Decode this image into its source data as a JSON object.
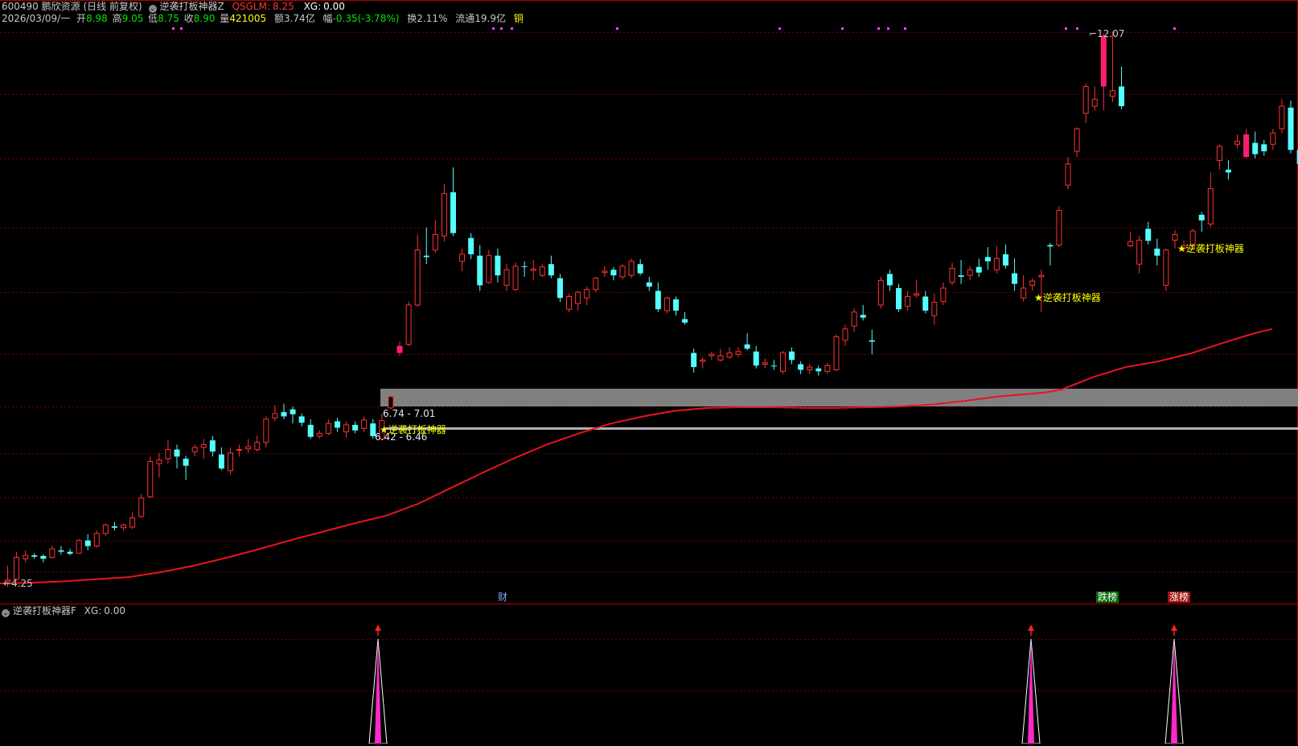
{
  "header": {
    "code": "600490",
    "name": "鹏欣资源",
    "period": "(日线 前复权)",
    "indicator_name": "逆袭打板神器Z",
    "qsglm_label": "QSGLM:",
    "qsglm_value": "8.25",
    "xg_label": "XG:",
    "xg_value": "0.00"
  },
  "quote": {
    "date": "2026/03/09/一",
    "open_label": "开",
    "open": "8.98",
    "high_label": "高",
    "high": "9.05",
    "low_label": "低",
    "low": "8.75",
    "close_label": "收",
    "close": "8.90",
    "volume_label": "量",
    "volume": "421005",
    "amount_label": "额",
    "amount": "3.74亿",
    "change_label": "幅",
    "change": "-0.35(-3.78%)",
    "turnover_label": "换",
    "turnover": "2.11%",
    "float_label": "流通",
    "float": "19.9亿",
    "extra": "铜"
  },
  "annotations": {
    "max_price": "12.07",
    "min_price": "4.25",
    "zone_upper": "6.74 - 7.01",
    "zone_lower": "6.42 - 6.46",
    "signal_label": "★逆袭打板神器"
  },
  "markers": {
    "finance": "财",
    "fall_list": "跌榜",
    "rise_list": "涨榜"
  },
  "sub_panel": {
    "title": "逆袭打板神器F",
    "xg_label": "XG:",
    "xg_value": "0.00"
  },
  "colors": {
    "up": "#ff3232",
    "down": "#54ffff",
    "ma": "#e8141e",
    "signal_candle": "#ff1e6e",
    "signal_text": "#ffff00",
    "zone": "#808080",
    "grid": "#700000",
    "spike": "#ff28c8"
  },
  "chart_data": {
    "type": "candlestick",
    "price_range": [
      4.0,
      12.2
    ],
    "candles": [
      [
        4.28,
        4.5,
        4.2,
        4.3
      ],
      [
        4.31,
        4.7,
        4.29,
        4.62
      ],
      [
        4.6,
        4.72,
        4.55,
        4.65
      ],
      [
        4.65,
        4.68,
        4.6,
        4.63
      ],
      [
        4.64,
        4.66,
        4.55,
        4.6
      ],
      [
        4.62,
        4.78,
        4.6,
        4.74
      ],
      [
        4.72,
        4.78,
        4.66,
        4.7
      ],
      [
        4.7,
        4.74,
        4.65,
        4.67
      ],
      [
        4.68,
        4.88,
        4.67,
        4.86
      ],
      [
        4.86,
        4.95,
        4.72,
        4.78
      ],
      [
        4.78,
        5.0,
        4.76,
        4.96
      ],
      [
        4.96,
        5.1,
        4.92,
        5.08
      ],
      [
        5.06,
        5.12,
        5.0,
        5.04
      ],
      [
        5.04,
        5.1,
        5.0,
        5.08
      ],
      [
        5.05,
        5.26,
        5.02,
        5.18
      ],
      [
        5.2,
        5.52,
        5.18,
        5.46
      ],
      [
        5.48,
        6.05,
        5.46,
        5.98
      ],
      [
        5.95,
        6.1,
        5.75,
        6.0
      ],
      [
        6.02,
        6.28,
        5.95,
        6.15
      ],
      [
        6.15,
        6.22,
        5.88,
        6.05
      ],
      [
        6.02,
        6.06,
        5.72,
        5.92
      ],
      [
        6.12,
        6.22,
        6.05,
        6.18
      ],
      [
        6.18,
        6.3,
        6.02,
        6.22
      ],
      [
        6.28,
        6.34,
        6.05,
        6.12
      ],
      [
        6.08,
        6.18,
        5.86,
        5.88
      ],
      [
        5.85,
        6.18,
        5.8,
        6.1
      ],
      [
        6.15,
        6.22,
        6.05,
        6.15
      ],
      [
        6.16,
        6.3,
        6.1,
        6.19
      ],
      [
        6.15,
        6.35,
        6.12,
        6.25
      ],
      [
        6.25,
        6.62,
        6.18,
        6.58
      ],
      [
        6.6,
        6.78,
        6.55,
        6.66
      ],
      [
        6.68,
        6.8,
        6.58,
        6.62
      ],
      [
        6.72,
        6.76,
        6.52,
        6.65
      ],
      [
        6.62,
        6.66,
        6.48,
        6.53
      ],
      [
        6.5,
        6.58,
        6.3,
        6.33
      ],
      [
        6.34,
        6.42,
        6.3,
        6.38
      ],
      [
        6.38,
        6.58,
        6.35,
        6.52
      ],
      [
        6.55,
        6.6,
        6.4,
        6.46
      ],
      [
        6.4,
        6.55,
        6.32,
        6.5
      ],
      [
        6.5,
        6.55,
        6.38,
        6.42
      ],
      [
        6.45,
        6.62,
        6.4,
        6.57
      ],
      [
        6.52,
        6.58,
        6.3,
        6.34
      ],
      [
        6.3,
        6.66,
        6.28,
        6.56
      ],
      [
        6.74,
        6.92,
        6.72,
        6.9
      ],
      [
        7.52,
        7.68,
        7.48,
        7.62
      ],
      [
        7.64,
        8.25,
        7.62,
        8.2
      ],
      [
        8.2,
        9.2,
        8.18,
        8.98
      ],
      [
        8.9,
        9.3,
        8.78,
        8.88
      ],
      [
        8.98,
        9.4,
        8.94,
        9.2
      ],
      [
        9.18,
        9.92,
        9.1,
        9.78
      ],
      [
        9.8,
        10.15,
        9.18,
        9.22
      ],
      [
        8.82,
        9.0,
        8.68,
        8.92
      ],
      [
        9.15,
        9.22,
        8.85,
        8.92
      ],
      [
        8.9,
        9.05,
        8.4,
        8.48
      ],
      [
        8.52,
        8.98,
        8.5,
        8.9
      ],
      [
        8.9,
        9.0,
        8.52,
        8.62
      ],
      [
        8.48,
        8.78,
        8.4,
        8.7
      ],
      [
        8.42,
        8.8,
        8.4,
        8.75
      ],
      [
        8.75,
        8.82,
        8.6,
        8.74
      ],
      [
        8.69,
        8.84,
        8.55,
        8.71
      ],
      [
        8.62,
        8.78,
        8.6,
        8.74
      ],
      [
        8.78,
        8.9,
        8.58,
        8.62
      ],
      [
        8.58,
        8.64,
        8.24,
        8.3
      ],
      [
        8.14,
        8.36,
        8.1,
        8.32
      ],
      [
        8.22,
        8.4,
        8.12,
        8.38
      ],
      [
        8.3,
        8.46,
        8.2,
        8.42
      ],
      [
        8.42,
        8.6,
        8.38,
        8.58
      ],
      [
        8.66,
        8.75,
        8.6,
        8.68
      ],
      [
        8.7,
        8.74,
        8.55,
        8.62
      ],
      [
        8.6,
        8.78,
        8.56,
        8.75
      ],
      [
        8.62,
        8.86,
        8.58,
        8.82
      ],
      [
        8.78,
        8.85,
        8.62,
        8.65
      ],
      [
        8.52,
        8.6,
        8.4,
        8.46
      ],
      [
        8.4,
        8.52,
        8.1,
        8.14
      ],
      [
        8.12,
        8.32,
        8.08,
        8.3
      ],
      [
        8.28,
        8.32,
        8.05,
        8.12
      ],
      [
        8.0,
        8.1,
        7.92,
        7.95
      ],
      [
        7.52,
        7.58,
        7.24,
        7.32
      ],
      [
        7.4,
        7.46,
        7.3,
        7.42
      ],
      [
        7.48,
        7.54,
        7.42,
        7.5
      ],
      [
        7.42,
        7.58,
        7.4,
        7.48
      ],
      [
        7.46,
        7.6,
        7.44,
        7.52
      ],
      [
        7.5,
        7.6,
        7.46,
        7.54
      ],
      [
        7.64,
        7.8,
        7.56,
        7.58
      ],
      [
        7.54,
        7.62,
        7.3,
        7.34
      ],
      [
        7.36,
        7.44,
        7.3,
        7.38
      ],
      [
        7.34,
        7.42,
        7.28,
        7.33
      ],
      [
        7.26,
        7.55,
        7.22,
        7.52
      ],
      [
        7.54,
        7.6,
        7.36,
        7.42
      ],
      [
        7.36,
        7.4,
        7.22,
        7.28
      ],
      [
        7.28,
        7.36,
        7.22,
        7.32
      ],
      [
        7.3,
        7.34,
        7.2,
        7.26
      ],
      [
        7.26,
        7.38,
        7.22,
        7.34
      ],
      [
        7.28,
        7.78,
        7.26,
        7.75
      ],
      [
        7.7,
        7.92,
        7.62,
        7.86
      ],
      [
        7.9,
        8.15,
        7.82,
        8.1
      ],
      [
        8.06,
        8.2,
        7.98,
        8.02
      ],
      [
        7.7,
        7.85,
        7.5,
        7.68
      ],
      [
        8.2,
        8.6,
        8.15,
        8.55
      ],
      [
        8.64,
        8.7,
        8.4,
        8.48
      ],
      [
        8.44,
        8.5,
        8.1,
        8.14
      ],
      [
        8.18,
        8.4,
        8.12,
        8.32
      ],
      [
        8.34,
        8.56,
        8.3,
        8.36
      ],
      [
        8.32,
        8.4,
        8.08,
        8.12
      ],
      [
        8.05,
        8.36,
        7.92,
        8.24
      ],
      [
        8.25,
        8.52,
        8.2,
        8.44
      ],
      [
        8.52,
        8.8,
        8.48,
        8.72
      ],
      [
        8.62,
        8.84,
        8.5,
        8.6
      ],
      [
        8.62,
        8.75,
        8.55,
        8.7
      ],
      [
        8.74,
        8.86,
        8.6,
        8.66
      ],
      [
        8.88,
        9.02,
        8.7,
        8.82
      ],
      [
        8.7,
        9.04,
        8.65,
        8.86
      ],
      [
        8.92,
        9.06,
        8.72,
        8.76
      ],
      [
        8.65,
        8.86,
        8.4,
        8.5
      ],
      [
        8.3,
        8.62,
        8.25,
        8.44
      ],
      [
        8.48,
        8.58,
        8.4,
        8.54
      ],
      [
        8.6,
        8.7,
        8.1,
        8.62
      ],
      [
        9.05,
        9.08,
        8.76,
        9.03
      ],
      [
        9.05,
        9.6,
        9.02,
        9.54
      ],
      [
        9.9,
        10.3,
        9.84,
        10.2
      ],
      [
        10.38,
        10.72,
        10.3,
        10.7
      ],
      [
        10.92,
        11.34,
        10.78,
        11.3
      ],
      [
        11.02,
        11.3,
        10.96,
        11.12
      ],
      [
        11.3,
        12.05,
        10.96,
        12.02
      ],
      [
        11.16,
        12.08,
        11.08,
        11.24
      ],
      [
        11.3,
        11.58,
        10.98,
        11.02
      ],
      [
        9.04,
        9.24,
        9.02,
        9.1
      ],
      [
        8.78,
        9.18,
        8.65,
        9.12
      ],
      [
        9.28,
        9.38,
        9.06,
        9.11
      ],
      [
        9.0,
        9.14,
        8.76,
        8.9
      ],
      [
        8.48,
        9.0,
        8.4,
        8.98
      ],
      [
        9.12,
        9.26,
        9.0,
        9.2
      ],
      [
        9.0,
        9.12,
        8.96,
        9.04
      ],
      [
        9.06,
        9.28,
        9.0,
        9.25
      ],
      [
        9.48,
        9.52,
        9.24,
        9.4
      ],
      [
        9.35,
        10.08,
        9.3,
        9.85
      ],
      [
        10.25,
        10.48,
        10.12,
        10.45
      ],
      [
        10.12,
        10.25,
        9.98,
        10.08
      ],
      [
        10.48,
        10.62,
        10.42,
        10.52
      ],
      [
        10.62,
        10.7,
        10.28,
        10.3
      ],
      [
        10.5,
        10.66,
        10.28,
        10.34
      ],
      [
        10.48,
        10.54,
        10.32,
        10.38
      ],
      [
        10.48,
        10.7,
        10.4,
        10.64
      ],
      [
        10.7,
        11.12,
        10.64,
        11.02
      ],
      [
        11.0,
        11.1,
        10.35,
        10.4
      ],
      [
        10.4,
        10.46,
        10.12,
        10.2
      ],
      [
        9.84,
        10.18,
        9.8,
        10.14
      ],
      [
        9.76,
        9.84,
        9.46,
        9.48
      ],
      [
        9.56,
        9.6,
        9.32,
        9.36
      ],
      [
        9.2,
        9.28,
        9.02,
        9.07
      ]
    ],
    "ma": [
      [
        0,
        4.25
      ],
      [
        40,
        4.26
      ],
      [
        80,
        4.28
      ],
      [
        120,
        4.31
      ],
      [
        160,
        4.34
      ],
      [
        200,
        4.41
      ],
      [
        240,
        4.5
      ],
      [
        280,
        4.61
      ],
      [
        320,
        4.73
      ],
      [
        360,
        4.86
      ],
      [
        400,
        4.98
      ],
      [
        440,
        5.1
      ],
      [
        480,
        5.21
      ],
      [
        520,
        5.38
      ],
      [
        560,
        5.6
      ],
      [
        600,
        5.82
      ],
      [
        640,
        6.03
      ],
      [
        680,
        6.22
      ],
      [
        720,
        6.38
      ],
      [
        760,
        6.52
      ],
      [
        800,
        6.62
      ],
      [
        840,
        6.7
      ],
      [
        880,
        6.74
      ],
      [
        920,
        6.75
      ],
      [
        960,
        6.75
      ],
      [
        1000,
        6.74
      ],
      [
        1040,
        6.74
      ],
      [
        1080,
        6.75
      ],
      [
        1120,
        6.76
      ],
      [
        1160,
        6.79
      ],
      [
        1200,
        6.84
      ],
      [
        1240,
        6.9
      ],
      [
        1280,
        6.94
      ],
      [
        1300,
        6.96
      ],
      [
        1320,
        7.0
      ],
      [
        1360,
        7.18
      ],
      [
        1400,
        7.32
      ],
      [
        1440,
        7.4
      ],
      [
        1480,
        7.51
      ],
      [
        1520,
        7.66
      ],
      [
        1560,
        7.8
      ],
      [
        1582,
        7.86
      ]
    ],
    "signal_candles": [
      44,
      123,
      139
    ],
    "spikes_x": [
      470,
      1282,
      1460
    ]
  }
}
